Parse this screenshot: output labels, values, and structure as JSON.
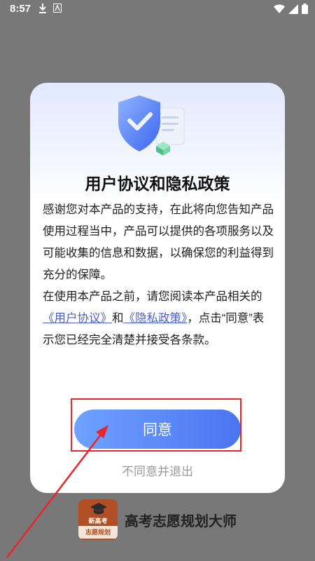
{
  "status_bar": {
    "time": "8:57",
    "icons": [
      "download-icon",
      "a-icon",
      "wifi-icon",
      "signal-icon",
      "battery-icon"
    ]
  },
  "dialog": {
    "illustration": "shield-check-icon",
    "title": "用户协议和隐私政策",
    "paragraph1": "感谢您对本产品的支持，在此将向您告知产品使用过程当中，产品可以提供的各项服务以及可能收集的信息和数据，以确保您的利益得到充分的保障。",
    "paragraph2_prefix": "在使用本产品之前，请您阅读本产品相关的",
    "user_agreement_link": "《用户协议》",
    "and_text": "和",
    "privacy_link": "《隐私政策》",
    "paragraph2_suffix": "，点击“同意”表示您已经完全清楚并接受各条款。",
    "agree_label": "同意",
    "decline_label": "不同意并退出"
  },
  "background_app": {
    "logo_line1": "新高考",
    "logo_line2": "志愿规划",
    "name": "高考志愿规划大师"
  },
  "colors": {
    "accent": "#4b74f1",
    "link": "#4a60c8",
    "annotation_red": "#e8262a"
  }
}
